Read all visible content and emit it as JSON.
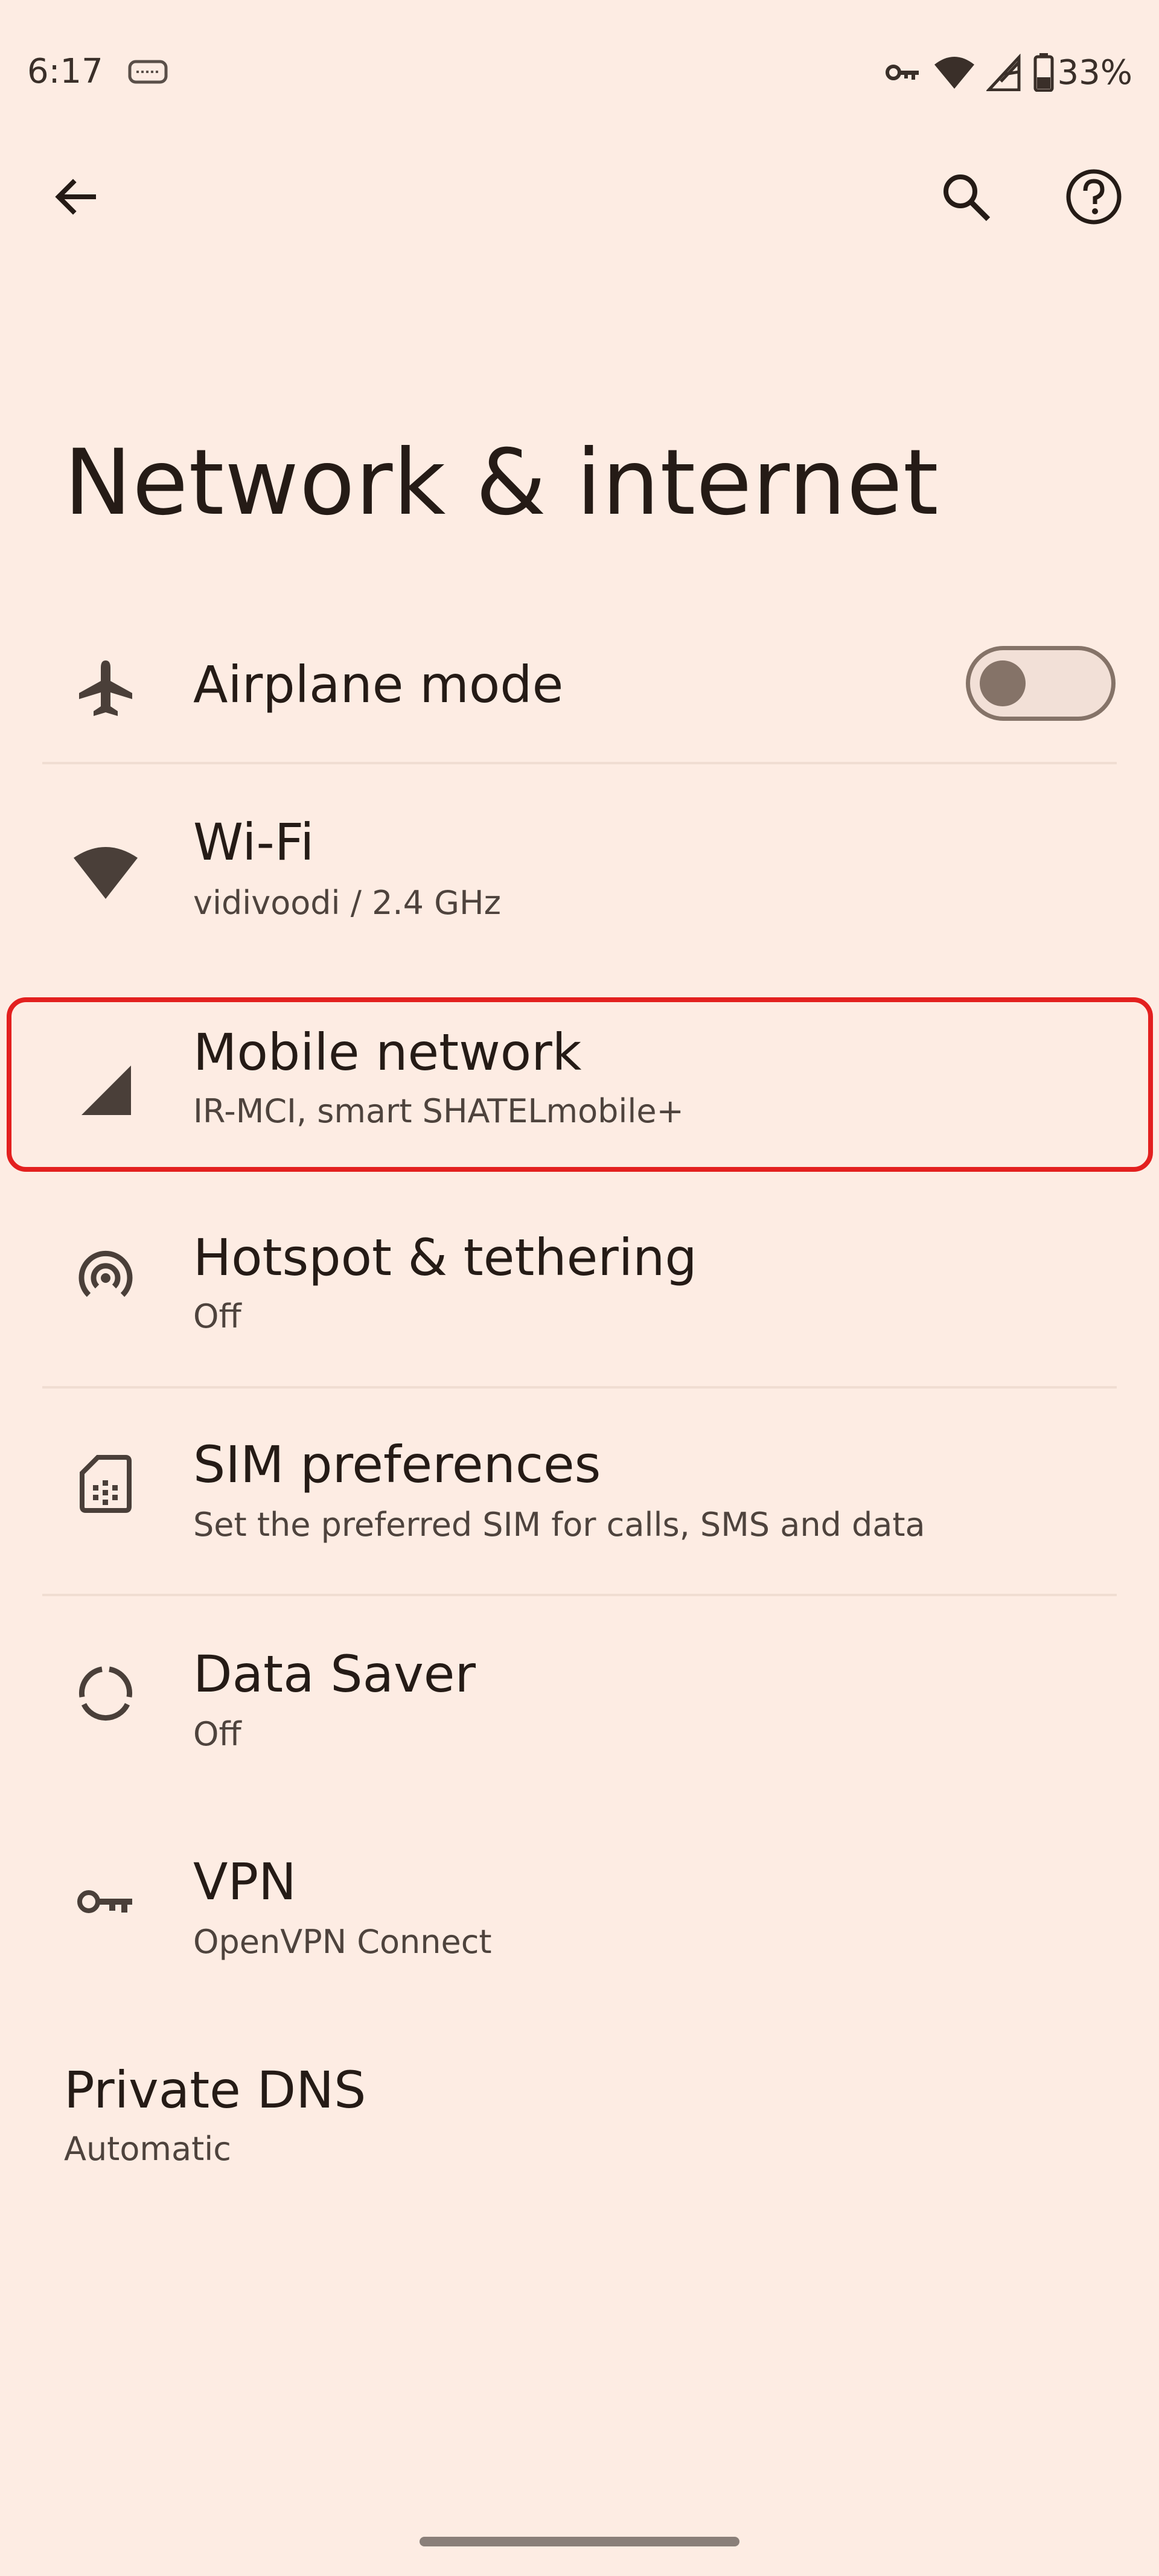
{
  "status_bar": {
    "time": "6:17",
    "battery_percent": "33%",
    "icons": [
      "notification-icon",
      "vpn-key-icon",
      "wifi-icon",
      "cell-signal-icon",
      "battery-icon"
    ]
  },
  "toolbar": {
    "back_icon": "arrow-back-icon",
    "search_icon": "search-icon",
    "help_icon": "help-icon"
  },
  "page": {
    "title": "Network & internet"
  },
  "settings": {
    "airplane": {
      "title": "Airplane mode",
      "enabled": false,
      "icon": "airplane-icon"
    },
    "wifi": {
      "title": "Wi-Fi",
      "subtitle": "vidivoodi / 2.4 GHz",
      "icon": "wifi-icon"
    },
    "mobile": {
      "title": "Mobile network",
      "subtitle": "IR-MCI, smart SHATELmobile+",
      "icon": "signal-icon"
    },
    "hotspot": {
      "title": "Hotspot & tethering",
      "subtitle": "Off",
      "icon": "hotspot-icon"
    },
    "sim": {
      "title": "SIM preferences",
      "subtitle": "Set the preferred SIM for calls, SMS and data",
      "icon": "sim-card-icon"
    },
    "datasaver": {
      "title": "Data Saver",
      "subtitle": "Off",
      "icon": "data-saver-icon"
    },
    "vpn": {
      "title": "VPN",
      "subtitle": "OpenVPN Connect",
      "icon": "vpn-key-icon"
    },
    "dns": {
      "title": "Private DNS",
      "subtitle": "Automatic"
    }
  },
  "colors": {
    "background": "#fdece3",
    "text_primary": "#251b16",
    "text_secondary": "#4e433d",
    "toggle_off": "#857368",
    "highlight": "#e3201f"
  }
}
